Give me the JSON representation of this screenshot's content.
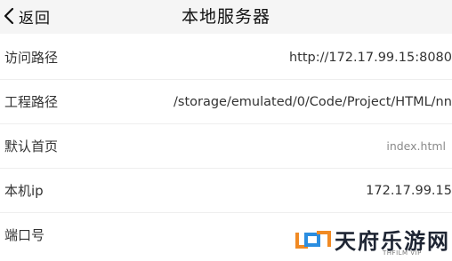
{
  "header": {
    "back_label": "返回",
    "title": "本地服务器"
  },
  "rows": [
    {
      "label": "访问路径",
      "value": "http://172.17.99.15:8080"
    },
    {
      "label": "工程路径",
      "value": "/storage/emulated/0/Code/Project/HTML/nn"
    },
    {
      "label": "默认首页",
      "value": "index.html"
    },
    {
      "label": "本机ip",
      "value": "172.17.99.15"
    },
    {
      "label": "端口号",
      "value": ""
    }
  ],
  "watermark": {
    "text": "天府乐游网",
    "sub": "THFILM VIP"
  },
  "colors": {
    "header_bg": "#f5f5f5",
    "background": "#ffffff",
    "divider": "#eeeeee",
    "watermark_orange": "#f08a24",
    "watermark_blue": "#2a8de0"
  }
}
